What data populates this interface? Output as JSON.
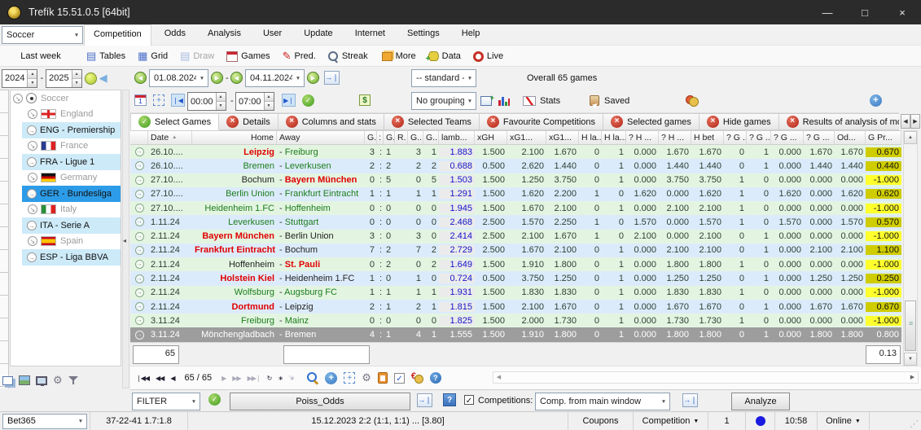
{
  "window": {
    "title": "Trefík 15.51.0.5 [64bit]",
    "min": "—",
    "max": "□",
    "close": "×"
  },
  "menu": {
    "sport_value": "Soccer",
    "tabs": [
      "Competition",
      "Odds",
      "Analysis",
      "User",
      "Update",
      "Internet",
      "Settings",
      "Help"
    ],
    "active_tab": "Competition",
    "last_week": "Last week"
  },
  "toolbar": {
    "items": [
      {
        "label": "Tables",
        "icon": "tables-icon"
      },
      {
        "label": "Grid",
        "icon": "grid-icon"
      },
      {
        "label": "Draw",
        "icon": "draw-icon",
        "disabled": true
      },
      {
        "label": "Games",
        "icon": "games-icon"
      },
      {
        "label": "Pred.",
        "icon": "pred-icon"
      },
      {
        "label": "Streak",
        "icon": "streak-icon"
      },
      {
        "label": "More",
        "icon": "more-icon"
      },
      {
        "label": "Data",
        "icon": "data-icon"
      },
      {
        "label": "Live",
        "icon": "live-icon"
      }
    ]
  },
  "filters": {
    "year_from": "2024",
    "year_to": "2025",
    "date_from": "01.08.2024",
    "date_to": "04.11.2024",
    "standard_value": "-- standard --",
    "overall": "Overall 65 games",
    "time_from": "00:00",
    "time_to": "07:00",
    "grouping_value": "No grouping",
    "stats_label": "Stats",
    "saved_label": "Saved"
  },
  "sidebar": {
    "items": [
      {
        "label": "Soccer",
        "type": "sport",
        "flag": "soccer"
      },
      {
        "label": "England",
        "type": "country",
        "flag": "england"
      },
      {
        "label": "ENG - Premiership",
        "type": "league"
      },
      {
        "label": "France",
        "type": "country",
        "flag": "france"
      },
      {
        "label": "FRA - Ligue 1",
        "type": "league"
      },
      {
        "label": "Germany",
        "type": "country",
        "flag": "germany"
      },
      {
        "label": "GER - Bundesliga",
        "type": "league",
        "selected": true
      },
      {
        "label": "Italy",
        "type": "country",
        "flag": "italy"
      },
      {
        "label": "ITA - Serie A",
        "type": "league"
      },
      {
        "label": "Spain",
        "type": "country",
        "flag": "spain"
      },
      {
        "label": "ESP - Liga BBVA",
        "type": "league"
      }
    ],
    "bottom_icons": [
      "windows-icon",
      "image-icon",
      "monitor-icon",
      "gear-icon",
      "funnel-icon"
    ]
  },
  "view_tabs": {
    "items": [
      {
        "label": "Select Games",
        "state": "check",
        "active": true
      },
      {
        "label": "Details",
        "state": "x"
      },
      {
        "label": "Columns and stats",
        "state": "x"
      },
      {
        "label": "Selected Teams",
        "state": "x"
      },
      {
        "label": "Favourite Competitions",
        "state": "x"
      },
      {
        "label": "Selected games",
        "state": "x"
      },
      {
        "label": "Hide games",
        "state": "x"
      },
      {
        "label": "Results of analysis of mor",
        "state": "x"
      }
    ]
  },
  "table": {
    "columns": [
      "",
      "Date",
      "Home",
      "Away",
      "G...",
      ":",
      "G...",
      "R.",
      "G..",
      "G..",
      "lamb...",
      "xGH",
      "xG1...",
      "xG1...",
      "H la...",
      "H la...",
      "? H ...",
      "? H ...",
      "H bet",
      "? G ...",
      "? G ...",
      "? G ...",
      "? G ...",
      "Od...",
      "G Pr..."
    ],
    "rows": [
      {
        "d": "26.10....",
        "h": "Leipzig",
        "hc": "red",
        "a": "Freiburg",
        "ac": "green",
        "s": [
          "3",
          "1"
        ],
        "g": [
          "3",
          "1"
        ],
        "lamb": "1.883",
        "n": [
          "1.500",
          "2.100",
          "1.670",
          "0",
          "1",
          "0.000",
          "1.670",
          "1.670",
          "0",
          "1",
          "0.000",
          "1.670",
          "1.670"
        ],
        "gpr": "0.670"
      },
      {
        "d": "26.10....",
        "h": "Bremen",
        "hc": "green",
        "a": "Leverkusen",
        "ac": "green",
        "s": [
          "2",
          "2"
        ],
        "g": [
          "2",
          "2"
        ],
        "lamb": "0.688",
        "n": [
          "0.500",
          "2.620",
          "1.440",
          "0",
          "1",
          "0.000",
          "1.440",
          "1.440",
          "0",
          "1",
          "0.000",
          "1.440",
          "1.440"
        ],
        "gpr": "0.440"
      },
      {
        "d": "27.10....",
        "h": "Bochum",
        "hc": "black",
        "a": "Bayern München",
        "ac": "red",
        "s": [
          "0",
          "5"
        ],
        "g": [
          "0",
          "5"
        ],
        "lamb": "1.503",
        "n": [
          "1.500",
          "1.250",
          "3.750",
          "0",
          "1",
          "0.000",
          "3.750",
          "3.750",
          "1",
          "0",
          "0.000",
          "0.000",
          "0.000"
        ],
        "gpr": "-1.000"
      },
      {
        "d": "27.10....",
        "h": "Berlin Union",
        "hc": "green",
        "a": "Frankfurt Eintracht",
        "ac": "green",
        "s": [
          "1",
          "1"
        ],
        "g": [
          "1",
          "1"
        ],
        "lamb": "1.291",
        "n": [
          "1.500",
          "1.620",
          "2.200",
          "1",
          "0",
          "1.620",
          "0.000",
          "1.620",
          "1",
          "0",
          "1.620",
          "0.000",
          "1.620"
        ],
        "gpr": "0.620"
      },
      {
        "d": "27.10....",
        "h": "Heidenheim 1.FC",
        "hc": "green",
        "a": "Hoffenheim",
        "ac": "green",
        "s": [
          "0",
          "0"
        ],
        "g": [
          "0",
          "0"
        ],
        "lamb": "1.945",
        "n": [
          "1.500",
          "1.670",
          "2.100",
          "0",
          "1",
          "0.000",
          "2.100",
          "2.100",
          "1",
          "0",
          "0.000",
          "0.000",
          "0.000"
        ],
        "gpr": "-1.000"
      },
      {
        "d": "1.11.24",
        "h": "Leverkusen",
        "hc": "green",
        "a": "Stuttgart",
        "ac": "green",
        "s": [
          "0",
          "0"
        ],
        "g": [
          "0",
          "0"
        ],
        "lamb": "2.468",
        "n": [
          "2.500",
          "1.570",
          "2.250",
          "1",
          "0",
          "1.570",
          "0.000",
          "1.570",
          "1",
          "0",
          "1.570",
          "0.000",
          "1.570"
        ],
        "gpr": "0.570"
      },
      {
        "d": "2.11.24",
        "h": "Bayern München",
        "hc": "red",
        "a": "Berlin Union",
        "ac": "black",
        "s": [
          "3",
          "0"
        ],
        "g": [
          "3",
          "0"
        ],
        "lamb": "2.414",
        "n": [
          "2.500",
          "2.100",
          "1.670",
          "1",
          "0",
          "2.100",
          "0.000",
          "2.100",
          "0",
          "1",
          "0.000",
          "0.000",
          "0.000"
        ],
        "gpr": "-1.000"
      },
      {
        "d": "2.11.24",
        "h": "Frankfurt Eintracht",
        "hc": "red",
        "a": "Bochum",
        "ac": "black",
        "s": [
          "7",
          "2"
        ],
        "g": [
          "7",
          "2"
        ],
        "lamb": "2.729",
        "n": [
          "2.500",
          "1.670",
          "2.100",
          "0",
          "1",
          "0.000",
          "2.100",
          "2.100",
          "0",
          "1",
          "0.000",
          "2.100",
          "2.100"
        ],
        "gpr": "1.100"
      },
      {
        "d": "2.11.24",
        "h": "Hoffenheim",
        "hc": "black",
        "a": "St. Pauli",
        "ac": "red",
        "s": [
          "0",
          "2"
        ],
        "g": [
          "0",
          "2"
        ],
        "lamb": "1.649",
        "n": [
          "1.500",
          "1.910",
          "1.800",
          "0",
          "1",
          "0.000",
          "1.800",
          "1.800",
          "1",
          "0",
          "0.000",
          "0.000",
          "0.000"
        ],
        "gpr": "-1.000"
      },
      {
        "d": "2.11.24",
        "h": "Holstein Kiel",
        "hc": "red",
        "a": "Heidenheim 1.FC",
        "ac": "black",
        "s": [
          "1",
          "0"
        ],
        "g": [
          "1",
          "0"
        ],
        "lamb": "0.724",
        "n": [
          "0.500",
          "3.750",
          "1.250",
          "0",
          "1",
          "0.000",
          "1.250",
          "1.250",
          "0",
          "1",
          "0.000",
          "1.250",
          "1.250"
        ],
        "gpr": "0.250"
      },
      {
        "d": "2.11.24",
        "h": "Wolfsburg",
        "hc": "green",
        "a": "Augsburg FC",
        "ac": "green",
        "s": [
          "1",
          "1"
        ],
        "g": [
          "1",
          "1"
        ],
        "lamb": "1.931",
        "n": [
          "1.500",
          "1.830",
          "1.830",
          "0",
          "1",
          "0.000",
          "1.830",
          "1.830",
          "1",
          "0",
          "0.000",
          "0.000",
          "0.000"
        ],
        "gpr": "-1.000"
      },
      {
        "d": "2.11.24",
        "h": "Dortmund",
        "hc": "red",
        "a": "Leipzig",
        "ac": "black",
        "s": [
          "2",
          "1"
        ],
        "g": [
          "2",
          "1"
        ],
        "lamb": "1.815",
        "n": [
          "1.500",
          "2.100",
          "1.670",
          "0",
          "1",
          "0.000",
          "1.670",
          "1.670",
          "0",
          "1",
          "0.000",
          "1.670",
          "1.670"
        ],
        "gpr": "0.670"
      },
      {
        "d": "3.11.24",
        "h": "Freiburg",
        "hc": "green",
        "a": "Mainz",
        "ac": "green",
        "s": [
          "0",
          "0"
        ],
        "g": [
          "0",
          "0"
        ],
        "lamb": "1.825",
        "n": [
          "1.500",
          "2.000",
          "1.730",
          "0",
          "1",
          "0.000",
          "1.730",
          "1.730",
          "1",
          "0",
          "0.000",
          "0.000",
          "0.000"
        ],
        "gpr": "-1.000"
      },
      {
        "d": "3.11.24",
        "h": "Mönchengladbach",
        "hc": "white",
        "a": "Bremen",
        "ac": "white",
        "s": [
          "4",
          "1"
        ],
        "g": [
          "4",
          "1"
        ],
        "lamb": "1.555",
        "n": [
          "1.500",
          "1.910",
          "1.800",
          "0",
          "1",
          "0.000",
          "1.800",
          "1.800",
          "0",
          "1",
          "0.000",
          "1.800",
          "1.800"
        ],
        "gpr": "0.800",
        "selected": true
      }
    ]
  },
  "footer": {
    "count": "65",
    "empty_value": "",
    "coef": "0.13",
    "nav": [
      {
        "icon": "nav-first-icon",
        "glyph": "❘◀◀"
      },
      {
        "icon": "nav-fast-prev-icon",
        "glyph": "◀◀"
      },
      {
        "icon": "nav-prev-icon",
        "glyph": "◀"
      },
      {
        "label": "65 / 65"
      },
      {
        "icon": "nav-next-icon",
        "glyph": "▶",
        "disabled": true
      },
      {
        "icon": "nav-fast-next-icon",
        "glyph": "▶▶",
        "disabled": true
      },
      {
        "icon": "nav-last-icon",
        "glyph": "▶▶❘",
        "disabled": true
      },
      {
        "icon": "refresh-icon",
        "glyph": "↻"
      },
      {
        "icon": "new-record-icon",
        "glyph": "∗"
      },
      {
        "icon": "insert-record-icon",
        "glyph": "'∗",
        "disabled": true
      },
      {
        "icon": "filter-funnel-icon"
      },
      {
        "icon": "search-icon"
      },
      {
        "icon": "add-circle-icon"
      },
      {
        "icon": "move-icon"
      },
      {
        "icon": "settings-gear-icon"
      },
      {
        "icon": "report-icon"
      },
      {
        "icon": "confirm-icon"
      },
      {
        "icon": "money-icon"
      },
      {
        "icon": "help-icon"
      }
    ]
  },
  "filter_bar": {
    "filter_label": "FILTER",
    "system_name": "Poiss_Odds",
    "competitions_label": "Competitions:",
    "competitions_value": "Comp. from main window",
    "analyze_label": "Analyze"
  },
  "status": {
    "bookmaker": "Bet365",
    "record": "37-22-41  1.7:1.8",
    "game_info": "15.12.2023 2:2 (1:1, 1:1) ... [3.80]",
    "coupons": "Coupons",
    "competition": "Competition",
    "count": "1",
    "time": "10:58",
    "online": "Online"
  },
  "colors": {
    "row_green": "#e3f5e1",
    "row_blue": "#dcebfb",
    "selected_row": "#9d9d9d",
    "positive_yellow": "#cfcc00",
    "negative_yellow": "#ffff2e",
    "team_red": "#e00000",
    "team_green": "#1c7d1c",
    "lambda_blue": "#1414c8",
    "sidebar_selected": "#2d9ce8",
    "titlebar": "#2b2b2b"
  }
}
